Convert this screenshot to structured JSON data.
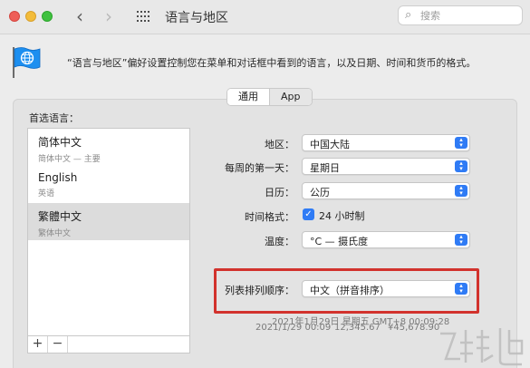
{
  "window": {
    "title": "语言与地区"
  },
  "search": {
    "placeholder": "搜索"
  },
  "description": "“语言与地区”偏好设置控制您在菜单和对话框中看到的语言，以及日期、时间和货币的格式。",
  "tabs": [
    {
      "label": "通用",
      "selected": true
    },
    {
      "label": "App",
      "selected": false
    }
  ],
  "languages": {
    "label": "首选语言：",
    "items": [
      {
        "name": "简体中文",
        "sub": "简体中文 — 主要"
      },
      {
        "name": "English",
        "sub": "英语"
      },
      {
        "name": "繁體中文",
        "sub": "繁体中文",
        "selected": true
      }
    ],
    "add_label": "+",
    "remove_label": "−"
  },
  "settings": {
    "region": {
      "label": "地区：",
      "value": "中国大陆"
    },
    "first_day": {
      "label": "每周的第一天：",
      "value": "星期日"
    },
    "calendar": {
      "label": "日历：",
      "value": "公历"
    },
    "time_format": {
      "label": "时间格式：",
      "value": "24 小时制",
      "checked": true
    },
    "temperature": {
      "label": "温度：",
      "value": "°C — 摄氏度"
    },
    "list_sort": {
      "label": "列表排列顺序：",
      "value": "中文（拼音排序）"
    }
  },
  "examples": {
    "line1": "2021年1月29日 星期五 GMT+8 00:09:28",
    "line2_date": "2021/1/29 00:09",
    "line2_number": "12,345.67",
    "line2_currency": "¥45,678.90"
  },
  "colors": {
    "accent": "#2f7bf5",
    "highlight": "#d2322d"
  },
  "icons": [
    "back-arrow-icon",
    "forward-arrow-icon",
    "grid-icon",
    "search-icon",
    "globe-flag-icon",
    "stepper-icon",
    "checkmark-icon"
  ]
}
